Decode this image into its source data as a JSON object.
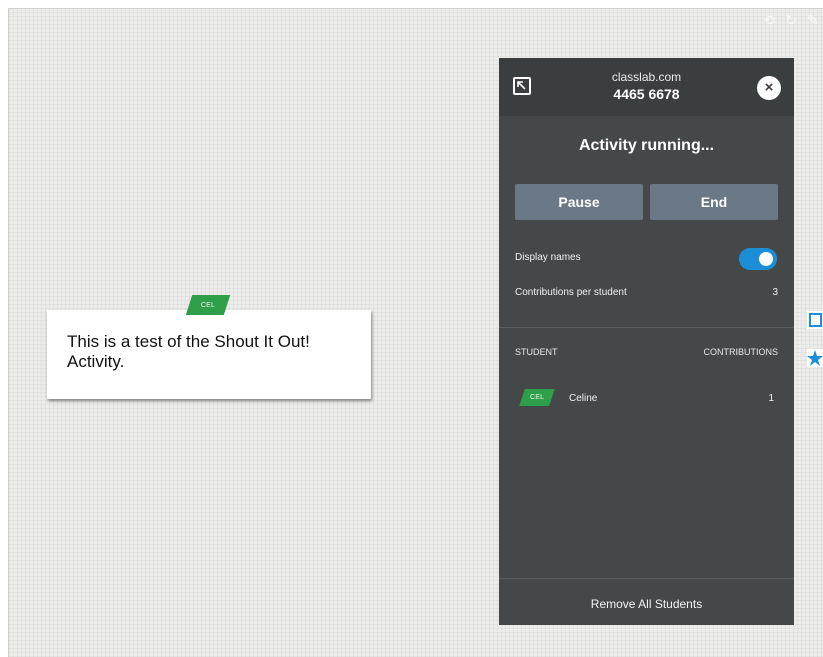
{
  "note": {
    "tag": "CEL",
    "text": "This is a test of the Shout It Out! Activity."
  },
  "panel": {
    "host": "classlab.com",
    "code": "4465 6678",
    "status": "Activity running...",
    "pause_label": "Pause",
    "end_label": "End",
    "settings": {
      "display_names_label": "Display names",
      "display_names_on": true,
      "contributions_label": "Contributions per student",
      "contributions_value": "3"
    },
    "table": {
      "student_header": "STUDENT",
      "contributions_header": "CONTRIBUTIONS",
      "rows": [
        {
          "tag": "CEL",
          "name": "Celine",
          "count": "1"
        }
      ]
    },
    "remove_label": "Remove All Students"
  },
  "colors": {
    "panel_bg": "#454849",
    "header_bg": "#3b3e3f",
    "button_bg": "#6b7986",
    "toggle_on": "#1a8fd8",
    "tag_green": "#2e9e48",
    "accent_blue": "#1a8fd8"
  },
  "icons": {
    "exit": "exit-fullscreen-icon",
    "close": "close-icon",
    "tools": [
      "eraser-icon",
      "undo-icon",
      "pen-icon"
    ],
    "side": [
      "whiteboard-icon",
      "star-icon"
    ]
  }
}
